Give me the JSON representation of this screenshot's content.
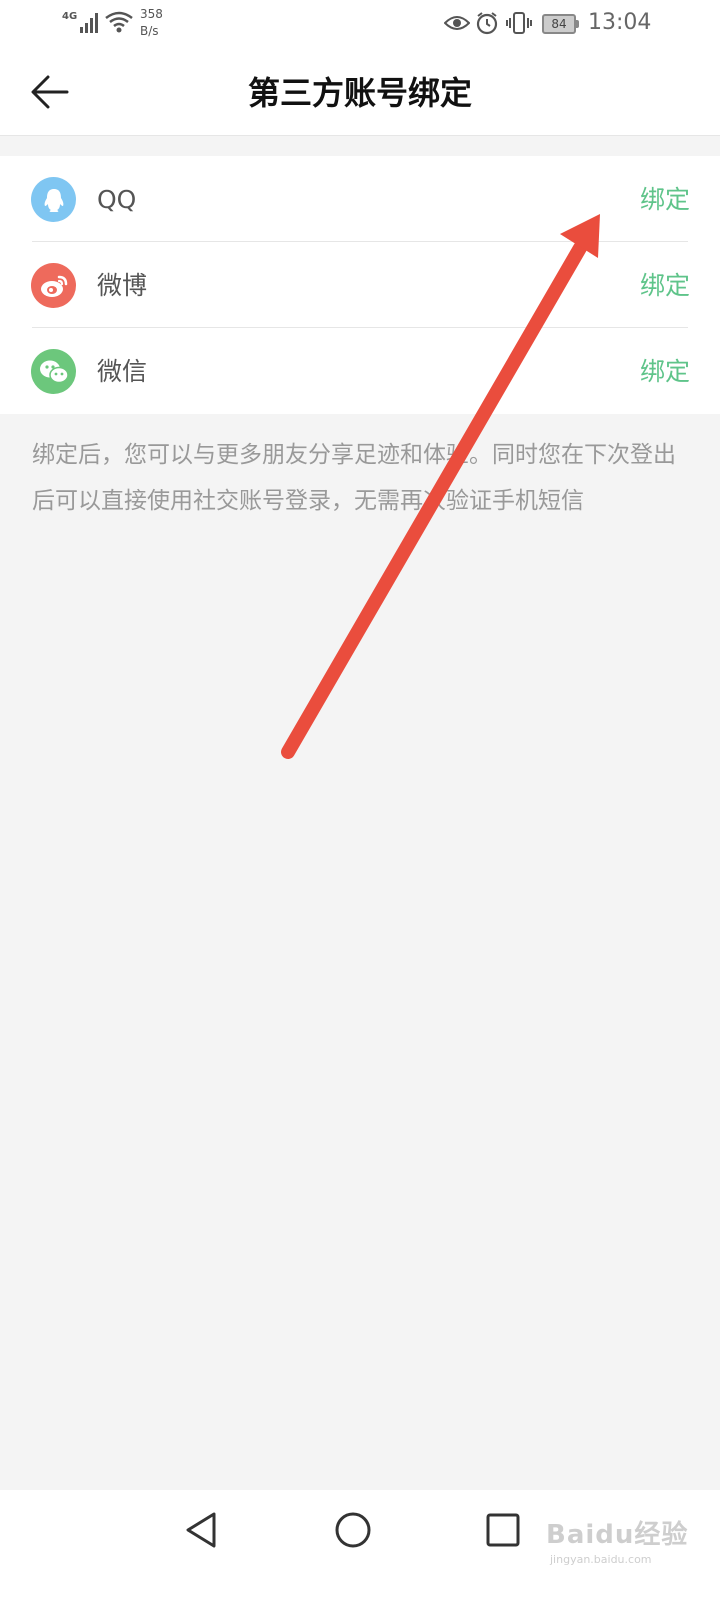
{
  "status_bar": {
    "network_label": "4G",
    "speed_value": "358",
    "speed_unit": "B/s",
    "battery": "84",
    "time": "13:04"
  },
  "header": {
    "title": "第三方账号绑定",
    "back_icon": "arrow-left-icon"
  },
  "accounts": [
    {
      "name": "QQ",
      "action": "绑定",
      "icon": "qq-icon",
      "color": "#7fc6f2"
    },
    {
      "name": "微博",
      "action": "绑定",
      "icon": "weibo-icon",
      "color": "#ee6a5c"
    },
    {
      "name": "微信",
      "action": "绑定",
      "icon": "wechat-icon",
      "color": "#6cc77c"
    }
  ],
  "hint": "绑定后，您可以与更多朋友分享足迹和体验。同时您在下次登出后可以直接使用社交账号登录，无需再次验证手机短信",
  "accent_color": "#5fc48a",
  "annotation_color": "#ea4d3d",
  "nav_bar": {
    "back_icon": "triangle-back-icon",
    "home_icon": "circle-home-icon",
    "recent_icon": "square-recent-icon"
  },
  "watermark": {
    "logo": "Baidu经验",
    "url": "jingyan.baidu.com"
  }
}
